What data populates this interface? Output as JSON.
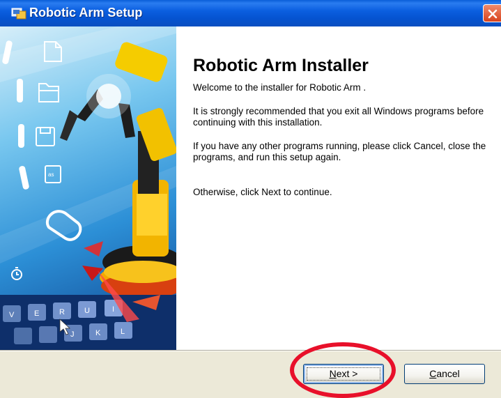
{
  "window": {
    "title": "Robotic Arm Setup"
  },
  "content": {
    "heading": "Robotic Arm Installer",
    "welcome": "Welcome to the installer for Robotic Arm .",
    "para1": "It is strongly recommended that you exit all Windows programs before continuing with this installation.",
    "para2": "If you have any other programs running, please click Cancel, close the programs, and run this setup again.",
    "para3": "Otherwise, click Next to continue."
  },
  "buttons": {
    "next_mnemonic": "N",
    "next_rest": "ext >",
    "cancel_mnemonic": "C",
    "cancel_rest": "ancel"
  },
  "art": {
    "keys": [
      "V",
      "E",
      "R",
      "U",
      "I",
      "J",
      "K",
      "L"
    ],
    "icons": [
      "document-icon",
      "folder-icon",
      "floppy-disk-icon",
      "text-file-icon",
      "mouse-icon",
      "timer-icon"
    ]
  },
  "colors": {
    "titlebar": "#0553d0",
    "highlight_ring": "#e8102a",
    "dialog_bg": "#ece9d8"
  }
}
